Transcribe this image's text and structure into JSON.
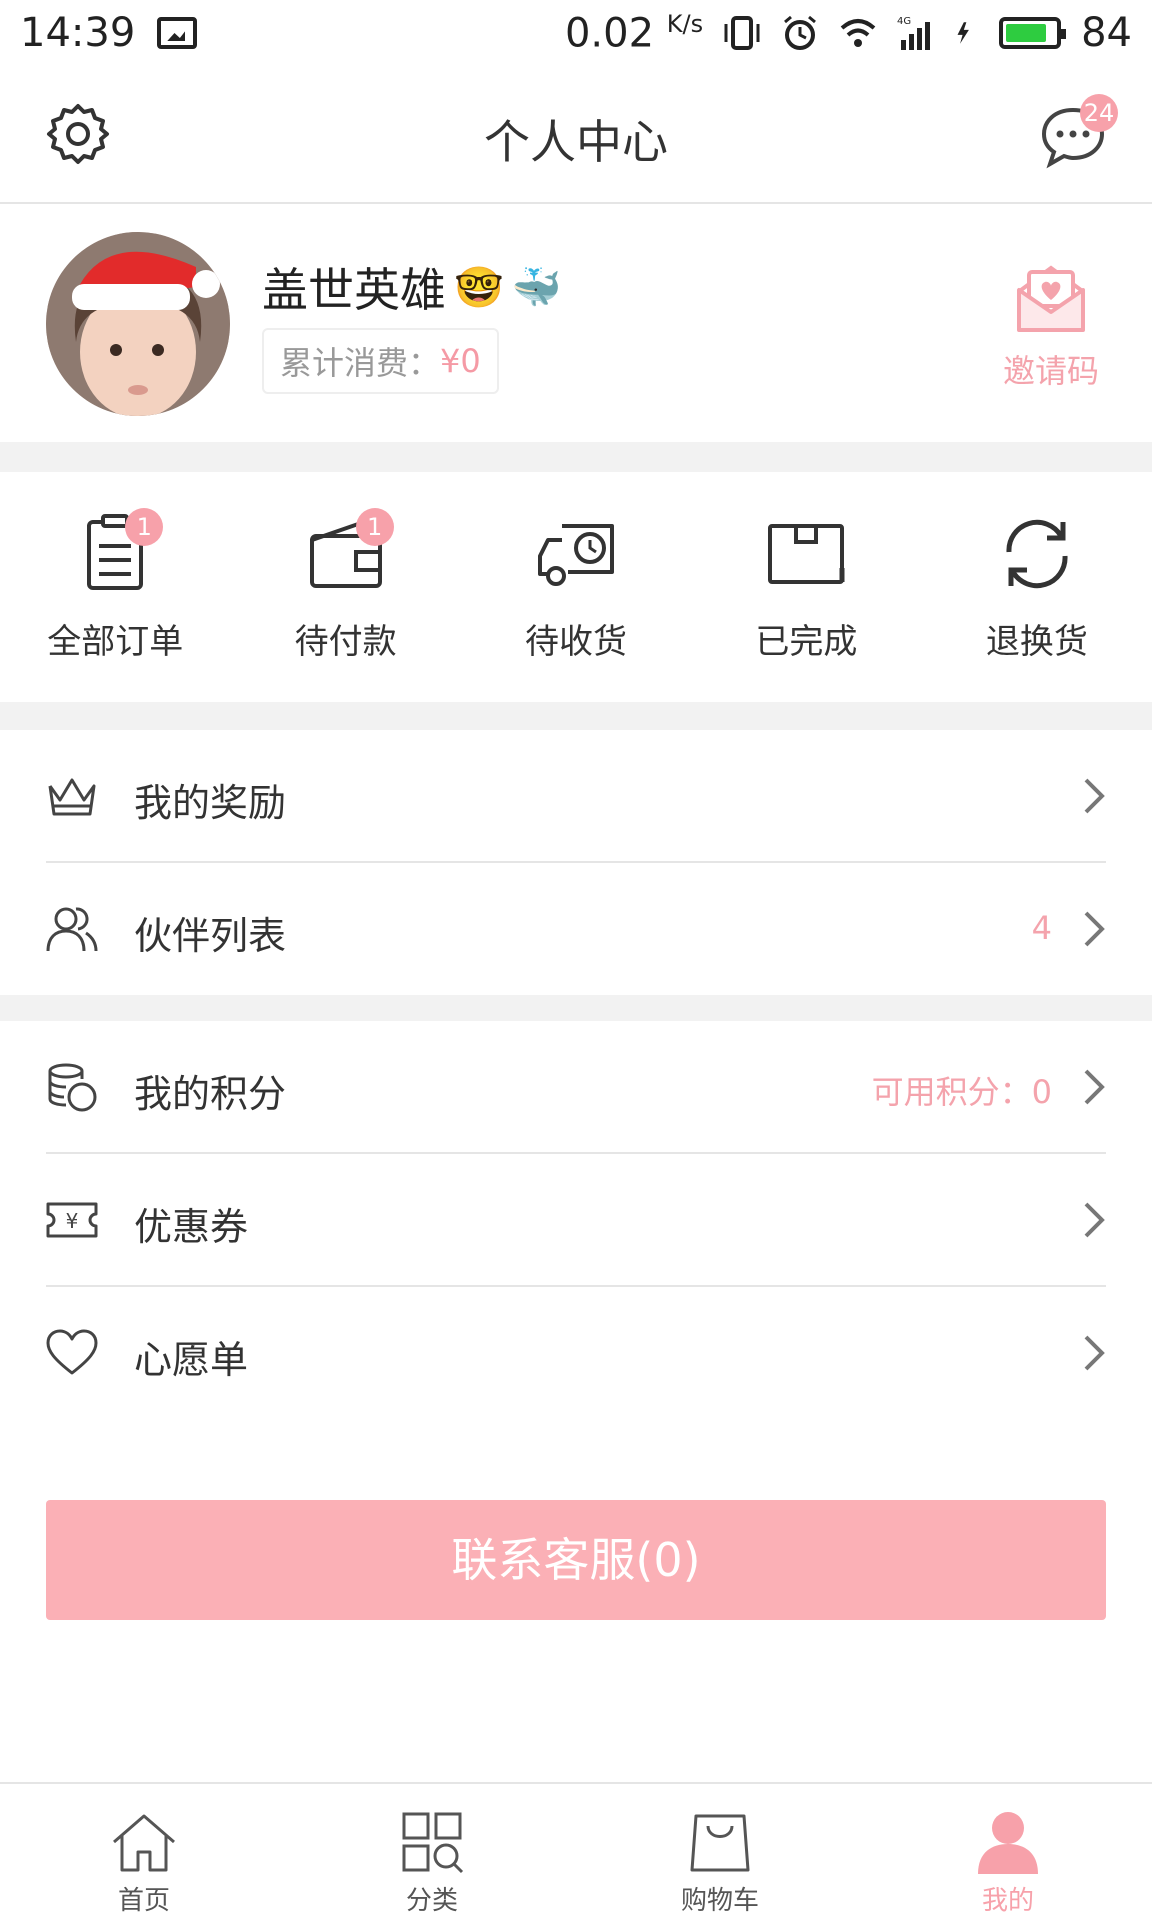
{
  "status_bar": {
    "time": "14:39",
    "speed": "0.02",
    "speed_unit": "K/s",
    "network": "4G",
    "battery": "84",
    "battery_level": 0.84
  },
  "header": {
    "title": "个人中心",
    "message_badge": "24"
  },
  "profile": {
    "username": "盖世英雄",
    "emojis": [
      "🤓",
      "🐳"
    ],
    "spend_label": "累计消费：",
    "spend_amount": "¥0",
    "invite_label": "邀请码"
  },
  "orders": [
    {
      "label": "全部订单",
      "icon": "clipboard-icon",
      "badge": "1"
    },
    {
      "label": "待付款",
      "icon": "wallet-icon",
      "badge": "1"
    },
    {
      "label": "待收货",
      "icon": "delivery-truck-icon",
      "badge": ""
    },
    {
      "label": "已完成",
      "icon": "box-icon",
      "badge": ""
    },
    {
      "label": "退换货",
      "icon": "refresh-icon",
      "badge": ""
    }
  ],
  "menu": {
    "rewards": {
      "label": "我的奖励",
      "icon": "crown-icon"
    },
    "partners": {
      "label": "伙伴列表",
      "icon": "users-icon",
      "extra": "4"
    },
    "points": {
      "label": "我的积分",
      "icon": "coins-icon",
      "extra": "可用积分：0"
    },
    "coupons": {
      "label": "优惠券",
      "icon": "coupon-icon"
    },
    "wishlist": {
      "label": "心愿单",
      "icon": "heart-icon"
    }
  },
  "contact_button": "联系客服(0)",
  "tabbar": [
    {
      "label": "首页",
      "icon": "home-icon"
    },
    {
      "label": "分类",
      "icon": "category-icon"
    },
    {
      "label": "购物车",
      "icon": "shopping-bag-icon"
    },
    {
      "label": "我的",
      "icon": "person-icon",
      "active": true
    }
  ],
  "colors": {
    "accent": "#f7a1aa",
    "button": "#fbb0b6",
    "text": "#333333",
    "divider": "#e5e5e5",
    "background_gap": "#f2f2f2"
  }
}
